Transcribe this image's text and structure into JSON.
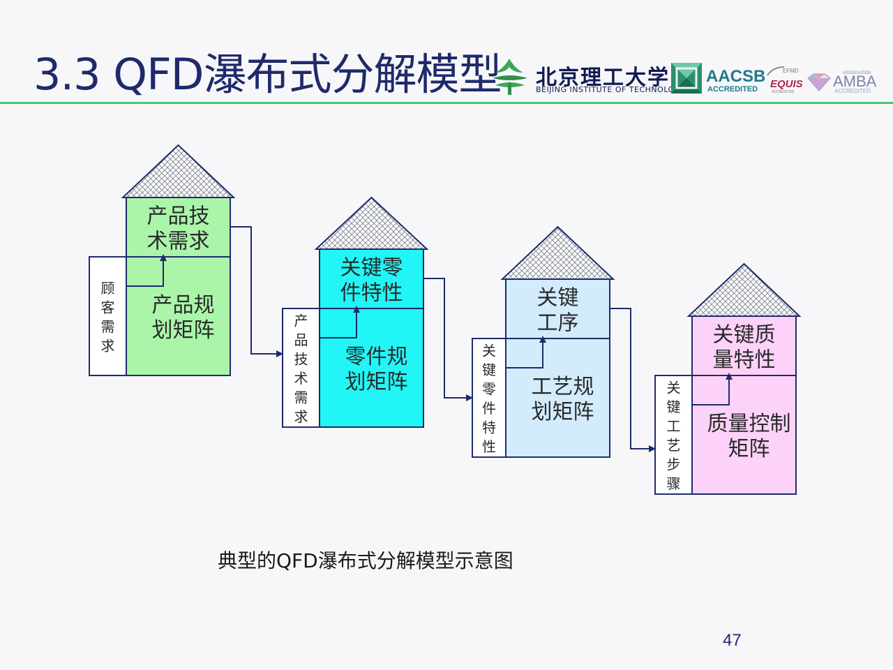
{
  "slide": {
    "title": "3.3 QFD瀑布式分解模型",
    "caption": "典型的QFD瀑布式分解模型示意图",
    "page_number": "47"
  },
  "logos": {
    "university_cn": "北京理工大学",
    "university_en": "BEIJING INSTITUTE OF TECHNOLOGY",
    "aacsb": "AACSB",
    "aacsb_sub": "ACCREDITED",
    "efmd": "EFMD",
    "equis": "EQUIS",
    "equis_sub": "ACCREDITED",
    "amba_assoc": "ASSOCIATION",
    "amba": "AMBA",
    "amba_sub": "ACCREDITED"
  },
  "houses": [
    {
      "roof_lines": [
        "产品技",
        "术需求"
      ],
      "matrix_lines": [
        "产品规",
        "划矩阵"
      ],
      "left_label": "顾客需求",
      "color": "#aaf5aa"
    },
    {
      "roof_lines": [
        "关键零",
        "件特性"
      ],
      "matrix_lines": [
        "零件规",
        "划矩阵"
      ],
      "left_label": "产品技术需求",
      "color": "#22f5f5"
    },
    {
      "roof_lines": [
        "关键",
        "工序"
      ],
      "matrix_lines": [
        "工艺规",
        "划矩阵"
      ],
      "left_label": "关键零件特性",
      "color": "#d2ecfc"
    },
    {
      "roof_lines": [
        "关键质",
        "量特性"
      ],
      "matrix_lines": [
        "质量控制",
        "矩阵"
      ],
      "left_label": "关键工艺步骤",
      "color": "#fcd2f8"
    }
  ]
}
